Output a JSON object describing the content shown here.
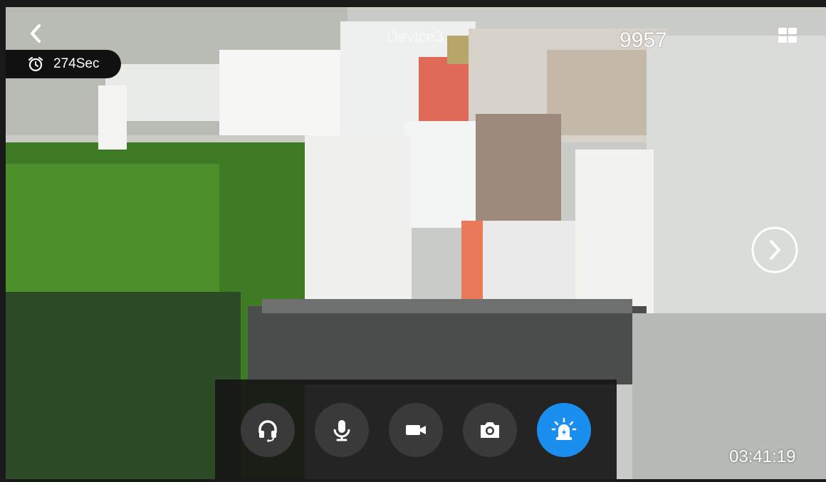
{
  "header": {
    "device_title": "Device3",
    "channel_number": "9957"
  },
  "timer": {
    "label": "274Sec"
  },
  "controls": {
    "buttons": [
      {
        "name": "headset",
        "icon": "headphones-icon"
      },
      {
        "name": "microphone",
        "icon": "microphone-icon"
      },
      {
        "name": "record",
        "icon": "video-camera-icon"
      },
      {
        "name": "snapshot",
        "icon": "camera-icon"
      },
      {
        "name": "alarm",
        "icon": "siren-icon",
        "active": true
      }
    ]
  },
  "clock": {
    "time": "03:41:19"
  },
  "colors": {
    "accent": "#1a8ff0",
    "control_bg": "#161616",
    "button_bg": "#3a3a3a"
  }
}
